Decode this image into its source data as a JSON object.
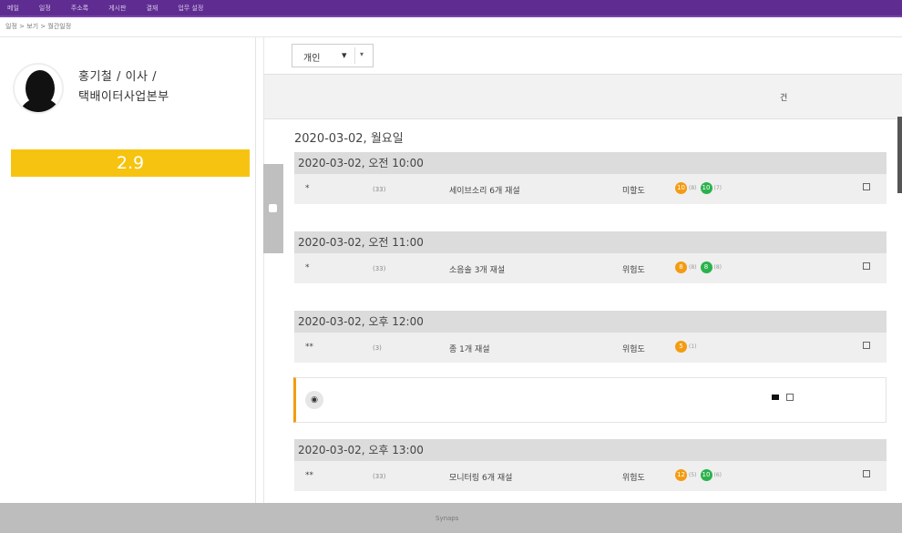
{
  "top_menu": {
    "items": [
      "메일",
      "일정",
      "주소록",
      "게시판",
      "결재",
      "업무 설정"
    ]
  },
  "breadcrumb": "일정 > 보기 > 월간일정",
  "profile": {
    "name_line": "홍기철 / 이사 /",
    "dept_line": "택배이터사업본부",
    "score": "2.9"
  },
  "filter": {
    "label": "개인",
    "icon": "filter-icon",
    "dropdown": "dropdown-arrow-icon"
  },
  "header_bar": {
    "right_label": "건"
  },
  "day_heading": "2020-03-02, 월요일",
  "groups": [
    {
      "time": "2020-03-02, 오전 10:00",
      "mark": "*",
      "code": "(33)",
      "title": "세이브소리 6개 재설",
      "status": "미할도",
      "badges": [
        "10",
        "10"
      ],
      "counts": [
        "(8)",
        "(7)"
      ]
    },
    {
      "time": "2020-03-02, 오전 11:00",
      "mark": "*",
      "code": "(33)",
      "title": "소음솔 3개 재설",
      "status": "위험도",
      "badges": [
        "8",
        "8"
      ],
      "counts": [
        "(8)",
        "(8)"
      ]
    },
    {
      "time": "2020-03-02, 오후 12:00",
      "mark": "**",
      "code": "(3)",
      "title": "종 1개 재설",
      "status": "위험도",
      "badges": [
        "5"
      ],
      "counts": [
        "(1)"
      ]
    },
    {
      "time": "2020-03-02, 오후 13:00",
      "mark": "**",
      "code": "(33)",
      "title": "모니터링 6개 재설",
      "status": "위험도",
      "badges": [
        "12",
        "10"
      ],
      "counts": [
        "(5)",
        "(6)"
      ]
    }
  ],
  "note": {
    "nav": "◉"
  },
  "footer": "Synaps"
}
